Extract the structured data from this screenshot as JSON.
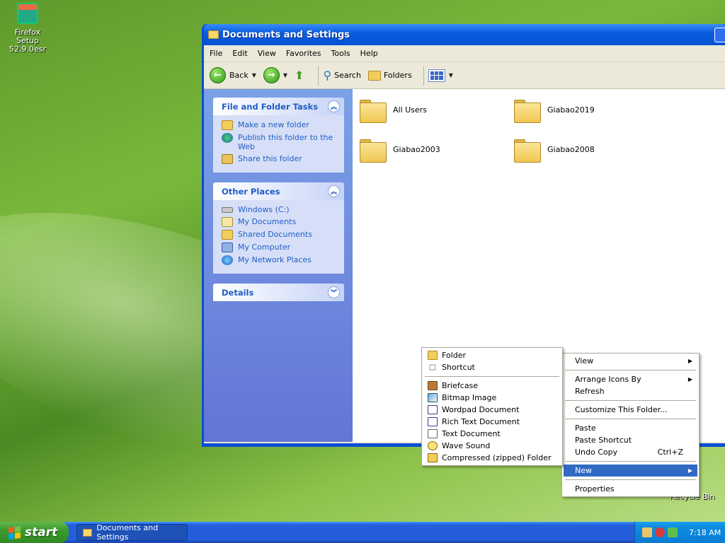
{
  "desktop": {
    "icons": [
      {
        "label": "Firefox Setup 52.9.0esr"
      }
    ],
    "recycle_bin_partial": "Recycle Bin"
  },
  "window": {
    "title": "Documents and Settings",
    "menu": [
      "File",
      "Edit",
      "View",
      "Favorites",
      "Tools",
      "Help"
    ],
    "toolbar": {
      "back": "Back",
      "search": "Search",
      "folders": "Folders"
    },
    "sidebar": {
      "file_tasks": {
        "title": "File and Folder Tasks",
        "items": [
          "Make a new folder",
          "Publish this folder to the Web",
          "Share this folder"
        ]
      },
      "other_places": {
        "title": "Other Places",
        "items": [
          "Windows (C:)",
          "My Documents",
          "Shared Documents",
          "My Computer",
          "My Network Places"
        ]
      },
      "details": {
        "title": "Details"
      }
    },
    "folders": [
      "All Users",
      "Giabao2019",
      "Giabao2003",
      "Giabao2008"
    ]
  },
  "context_menu": {
    "view": "View",
    "arrange": "Arrange Icons By",
    "refresh": "Refresh",
    "customize": "Customize This Folder...",
    "paste": "Paste",
    "paste_shortcut": "Paste Shortcut",
    "undo": "Undo Copy",
    "undo_shortcut": "Ctrl+Z",
    "new": "New",
    "properties": "Properties"
  },
  "new_submenu": {
    "folder": "Folder",
    "shortcut": "Shortcut",
    "items": [
      "Briefcase",
      "Bitmap Image",
      "Wordpad Document",
      "Rich Text Document",
      "Text Document",
      "Wave Sound",
      "Compressed (zipped) Folder"
    ]
  },
  "taskbar": {
    "start": "start",
    "task": "Documents and Settings",
    "clock": "7:18 AM"
  }
}
